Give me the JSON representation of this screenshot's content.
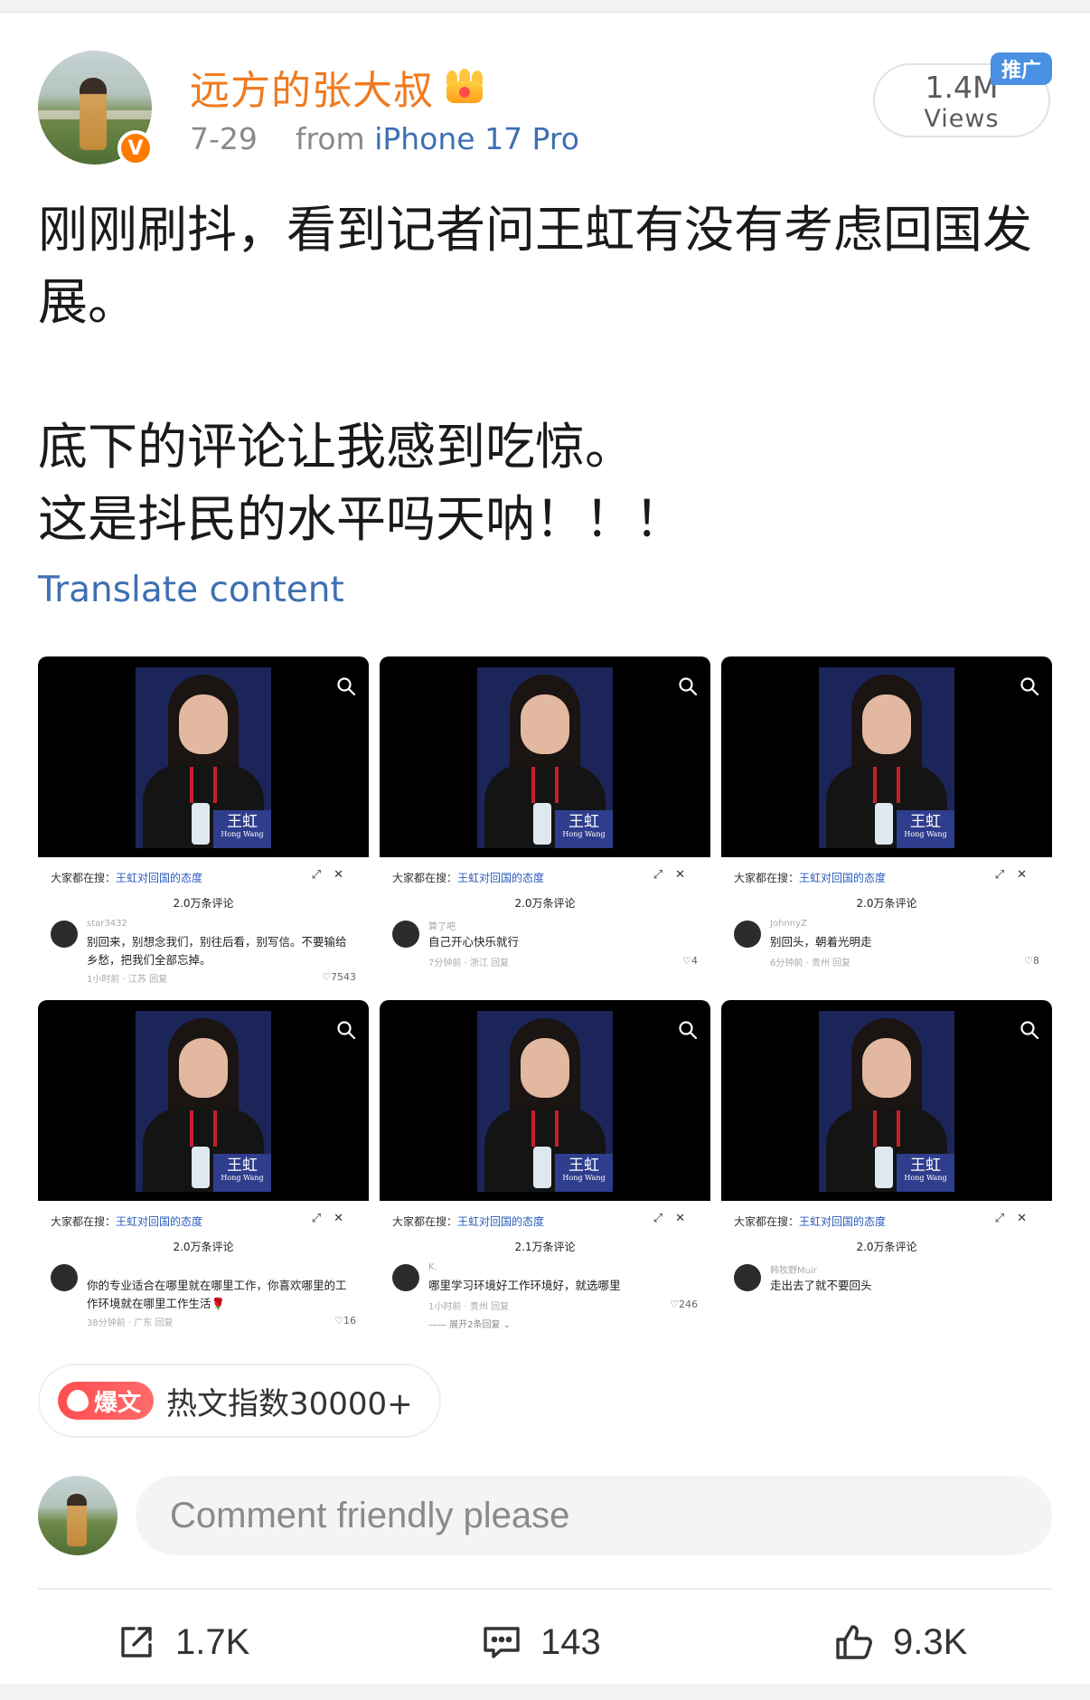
{
  "post": {
    "username": "远方的张大叔",
    "date": "7-29",
    "from_label": "from",
    "device": "iPhone 17 Pro",
    "views_count": "1.4M",
    "views_label": "Views",
    "promo_badge": "推广",
    "text_lines": [
      "刚刚刷抖，看到记者问王虹有没有考虑回国发展。",
      "",
      "底下的评论让我感到吃惊。",
      "这是抖民的水平吗天呐！！！"
    ],
    "translate_label": "Translate content"
  },
  "screenshots": [
    {
      "search_prefix": "大家都在搜：",
      "search_keyword": "王虹对回国的态度",
      "comment_count": "2.0万条评论",
      "nameplate": "王虹",
      "nameplate_en": "Hong Wang",
      "user": "star3432",
      "comment": "别回来，别想念我们，别往后看，别写信。不要输给乡愁，把我们全部忘掉。",
      "meta": "1小时前 · 江苏   回复",
      "likes": "♡7543"
    },
    {
      "search_prefix": "大家都在搜：",
      "search_keyword": "王虹对回国的态度",
      "comment_count": "2.0万条评论",
      "nameplate": "王虹",
      "nameplate_en": "Hong Wang",
      "user": "算了吧",
      "comment": "自己开心快乐就行",
      "meta": "7分钟前 · 浙江   回复",
      "likes": "♡4"
    },
    {
      "search_prefix": "大家都在搜：",
      "search_keyword": "王虹对回国的态度",
      "comment_count": "2.0万条评论",
      "nameplate": "王虹",
      "nameplate_en": "Hong Wang",
      "user": "JohnnyZ",
      "comment": "别回头，朝着光明走",
      "meta": "6分钟前 · 贵州   回复",
      "likes": "♡8"
    },
    {
      "search_prefix": "大家都在搜：",
      "search_keyword": "王虹对回国的态度",
      "comment_count": "2.0万条评论",
      "nameplate": "王虹",
      "nameplate_en": "Hong Wang",
      "user": "",
      "comment": "你的专业适合在哪里就在哪里工作，你喜欢哪里的工作环境就在哪里工作生活🌹",
      "meta": "38分钟前 · 广东   回复",
      "likes": "♡16"
    },
    {
      "search_prefix": "大家都在搜：",
      "search_keyword": "王虹对回国的态度",
      "comment_count": "2.1万条评论",
      "nameplate": "王虹",
      "nameplate_en": "Hong Wang",
      "user": "K.",
      "comment": "哪里学习环境好工作环境好，就选哪里",
      "meta": "1小时前 · 贵州   回复",
      "likes": "♡246",
      "extra": "—— 展开2条回复 ⌄"
    },
    {
      "search_prefix": "大家都在搜：",
      "search_keyword": "王虹对回国的态度",
      "comment_count": "2.0万条评论",
      "nameplate": "王虹",
      "nameplate_en": "Hong Wang",
      "user": "韩牧野Muir",
      "comment": "走出去了就不要回头",
      "meta": "",
      "likes": ""
    }
  ],
  "hot": {
    "tag": "爆文",
    "text": "热文指数30000+"
  },
  "comment_box": {
    "placeholder": "Comment friendly please"
  },
  "actions": {
    "share_count": "1.7K",
    "comment_count": "143",
    "like_count": "9.3K"
  },
  "colors": {
    "username": "#f07a1f",
    "link": "#3d70b2",
    "promo": "#4a90e2",
    "hot_tag": "#ff4d4f"
  },
  "icons": [
    "verified-icon",
    "crown-icon",
    "zoom-icon",
    "share-icon",
    "comment-icon",
    "like-icon",
    "flame-icon"
  ]
}
